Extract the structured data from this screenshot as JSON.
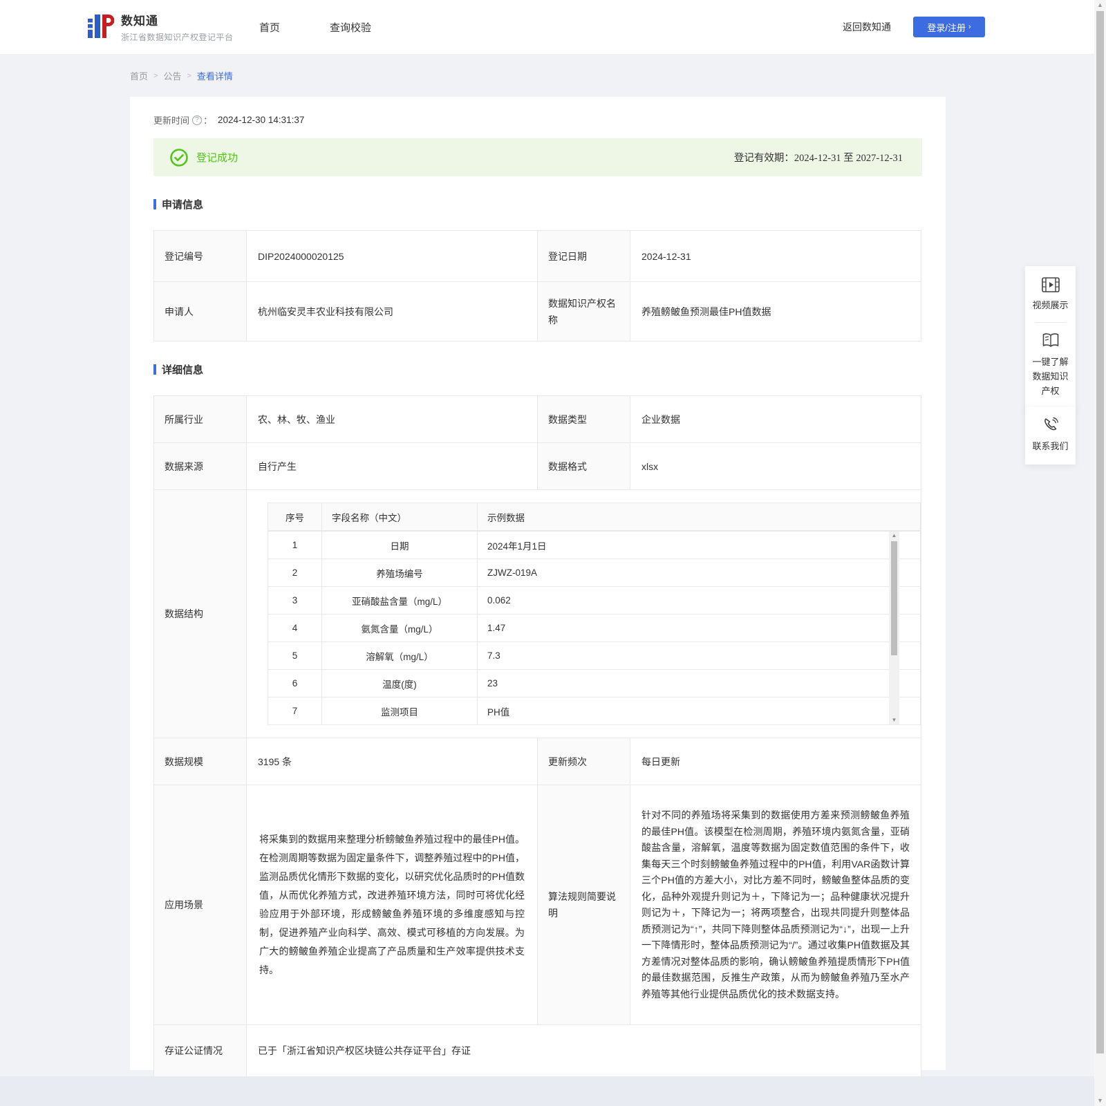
{
  "colors": {
    "accent": "#3d6be0",
    "success": "#52c41a",
    "banner_bg": "#eef7e6"
  },
  "brand": {
    "name": "数知通",
    "subtitle": "浙江省数据知识产权登记平台"
  },
  "nav": {
    "home": "首页",
    "verify": "查询校验",
    "back": "返回数知通",
    "login": "登录/注册",
    "login_arrow": "›"
  },
  "breadcrumb": {
    "level1": "首页",
    "level2": "公告",
    "level3": "查看详情",
    "separator": ">"
  },
  "meta": {
    "update_label": "更新时间",
    "question_mark": "?",
    "colon": "：",
    "update_time": "2024-12-30 14:31:37"
  },
  "banner": {
    "status": "登记成功",
    "validity": "登记有效期：2024-12-31 至 2027-12-31"
  },
  "sections": {
    "application": "申请信息",
    "detail": "详细信息"
  },
  "application": {
    "reg_no_label": "登记编号",
    "reg_no": "DIP2024000020125",
    "reg_date_label": "登记日期",
    "reg_date": "2024-12-31",
    "applicant_label": "申请人",
    "applicant": "杭州临安灵丰农业科技有限公司",
    "ip_name_label": "数据知识产权名称",
    "ip_name": "养殖鳑鲏鱼预测最佳PH值数据"
  },
  "detail": {
    "industry_label": "所属行业",
    "industry": "农、林、牧、渔业",
    "data_type_label": "数据类型",
    "data_type": "企业数据",
    "source_label": "数据来源",
    "source": "自行产生",
    "format_label": "数据格式",
    "format": "xlsx",
    "structure_label": "数据结构",
    "structure": {
      "headers": {
        "no": "序号",
        "field": "字段名称（中文）",
        "sample": "示例数据"
      },
      "rows": [
        {
          "no": "1",
          "field": "日期",
          "sample": "2024年1月1日"
        },
        {
          "no": "2",
          "field": "养殖场编号",
          "sample": "ZJWZ-019A"
        },
        {
          "no": "3",
          "field": "亚硝酸盐含量（mg/L）",
          "sample": "0.062"
        },
        {
          "no": "4",
          "field": "氨氮含量（mg/L）",
          "sample": "1.47"
        },
        {
          "no": "5",
          "field": "溶解氧（mg/L）",
          "sample": "7.3"
        },
        {
          "no": "6",
          "field": "温度(度)",
          "sample": "23"
        },
        {
          "no": "7",
          "field": "监测项目",
          "sample": "PH值"
        }
      ]
    },
    "scale_label": "数据规模",
    "scale": "3195 条",
    "frequency_label": "更新频次",
    "frequency": "每日更新",
    "scenario_label": "应用场景",
    "scenario": "将采集到的数据用来整理分析鳑鲏鱼养殖过程中的最佳PH值。在检测周期等数据为固定量条件下，调整养殖过程中的PH值，监测品质优化情形下数据的变化，以研究优化品质时的PH值数值，从而优化养殖方式，改进养殖环境方法，同时可将优化经验应用于外部环境，形成鳑鲏鱼养殖环境的多维度感知与控制，促进养殖产业向科学、高效、模式可移植的方向发展。为广大的鳑鲏鱼养殖企业提高了产品质量和生产效率提供技术支持。",
    "algorithm_label": "算法规则简要说明",
    "algorithm": "针对不同的养殖场将采集到的数据使用方差来预测鳑鲏鱼养殖的最佳PH值。该模型在检测周期，养殖环境内氨氮含量，亚硝酸盐含量，溶解氧，温度等数据为固定数值范围的条件下，收集每天三个时刻鳑鲏鱼养殖过程中的PH值，利用VAR函数计算三个PH值的方差大小，对比方差不同时，鳑鲏鱼整体品质的变化，品种外观提升则记为＋，下降记为一；品种健康状况提升则记为＋，下降记为一；将两项整合，出现共同提升则整体品质预测记为“↑”，共同下降则整体品质预测记为“↓”，出现一上升一下降情形时，整体品质预测记为“/”。通过收集PH值数据及其方差情况对整体品质的影响，确认鳑鲏鱼养殖提质情形下PH值的最佳数据范围，反推生产政策，从而为鳑鲏鱼养殖乃至水产养殖等其他行业提供品质优化的技术数据支持。",
    "evidence_label": "存证公证情况",
    "evidence": "已于「浙江省知识产权区块链公共存证平台」存证"
  },
  "floating": {
    "video": "视频展示",
    "guide": "一键了解数据知识产权",
    "contact": "联系我们"
  }
}
